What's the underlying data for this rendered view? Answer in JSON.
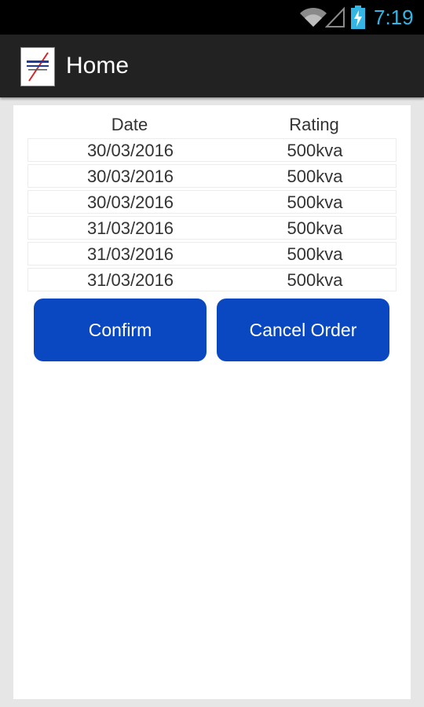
{
  "status_bar": {
    "time": "7:19",
    "icons": [
      "wifi-icon",
      "signal-icon",
      "battery-charging-icon"
    ],
    "time_color": "#33b5e5"
  },
  "action_bar": {
    "title": "Home",
    "logo_icon": "app-logo"
  },
  "table": {
    "columns": [
      "Date",
      "Rating"
    ],
    "rows": [
      {
        "date": "30/03/2016",
        "rating": "500kva"
      },
      {
        "date": "30/03/2016",
        "rating": "500kva"
      },
      {
        "date": "30/03/2016",
        "rating": "500kva"
      },
      {
        "date": "31/03/2016",
        "rating": "500kva"
      },
      {
        "date": "31/03/2016",
        "rating": "500kva"
      },
      {
        "date": "31/03/2016",
        "rating": "500kva"
      }
    ]
  },
  "buttons": {
    "confirm_label": "Confirm",
    "cancel_label": "Cancel Order",
    "color": "#0a48c2"
  }
}
